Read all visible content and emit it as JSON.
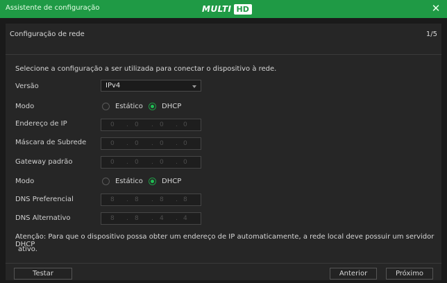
{
  "window": {
    "title": "Assistente de configuração",
    "logo_multi": "MULTI",
    "logo_hd": "HD",
    "close_glyph": "✕",
    "accent_color": "#1f9a45"
  },
  "step": {
    "title": "Configuração de rede",
    "counter": "1/5"
  },
  "form": {
    "intro": "Selecione a configuração a ser utilizada para conectar o dispositivo à rede.",
    "version_label": "Versão",
    "version_value": "IPv4",
    "mode_label": "Modo",
    "mode_static": "Estático",
    "mode_dhcp": "DHCP",
    "mode_selected": "DHCP",
    "ip_label": "Endereço de IP",
    "ip_value": [
      "0",
      "0",
      "0",
      "0"
    ],
    "mask_label": "Máscara de Subrede",
    "mask_value": [
      "0",
      "0",
      "0",
      "0"
    ],
    "gateway_label": "Gateway padrão",
    "gateway_value": [
      "0",
      "0",
      "0",
      "0"
    ],
    "dns_mode_label": "Modo",
    "dns_mode_static": "Estático",
    "dns_mode_dhcp": "DHCP",
    "dns_mode_selected": "DHCP",
    "dns_pref_label": "DNS Preferencial",
    "dns_pref_value": [
      "8",
      "8",
      "8",
      "8"
    ],
    "dns_alt_label": "DNS Alternativo",
    "dns_alt_value": [
      "8",
      "8",
      "4",
      "4"
    ],
    "ip_separator": "."
  },
  "notice": {
    "line1": "Atenção: Para que o dispositivo possa obter um endereço de IP automaticamente, a rede local deve possuir um servidor DHCP",
    "line2": "ativo."
  },
  "buttons": {
    "test": "Testar",
    "previous": "Anterior",
    "next": "Próximo"
  }
}
